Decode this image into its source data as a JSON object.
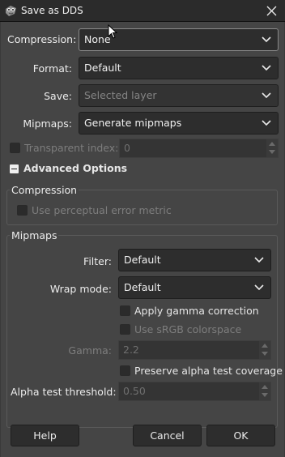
{
  "window": {
    "title": "Save as DDS"
  },
  "fields": {
    "compression": {
      "label": "Compression:",
      "value": "None"
    },
    "format": {
      "label": "Format:",
      "value": "Default"
    },
    "save": {
      "label": "Save:",
      "value": "Selected layer"
    },
    "mipmaps": {
      "label": "Mipmaps:",
      "value": "Generate mipmaps"
    },
    "transparent_index": {
      "label": "Transparent index:",
      "value": "0",
      "checked": false
    }
  },
  "advanced": {
    "label": "Advanced Options",
    "compression_group": {
      "title": "Compression",
      "perceptual_label": "Use perceptual error metric",
      "perceptual_checked": false
    },
    "mipmaps_group": {
      "title": "Mipmaps",
      "filter": {
        "label": "Filter:",
        "value": "Default"
      },
      "wrap_mode": {
        "label": "Wrap mode:",
        "value": "Default"
      },
      "apply_gamma_label": "Apply gamma correction",
      "use_srgb_label": "Use sRGB colorspace",
      "gamma": {
        "label": "Gamma:",
        "value": "2.2"
      },
      "preserve_alpha_label": "Preserve alpha test coverage",
      "alpha_threshold": {
        "label": "Alpha test threshold:",
        "value": "0.50"
      }
    }
  },
  "buttons": {
    "help": "Help",
    "cancel": "Cancel",
    "ok": "OK"
  },
  "colors": {
    "background": "#454545",
    "field": "#2d2d2d",
    "titlebar": "#2b2b2b"
  }
}
